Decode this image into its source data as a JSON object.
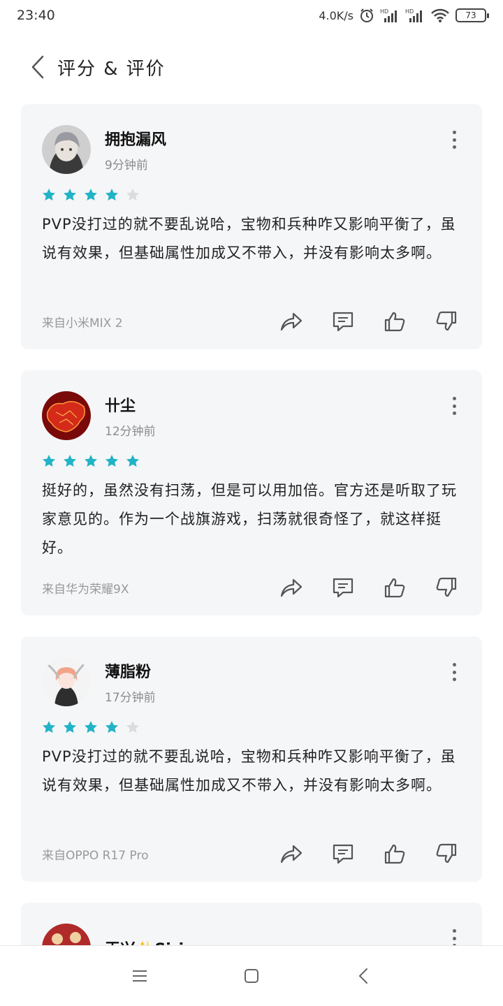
{
  "status_bar": {
    "time": "23:40",
    "speed": "4.0K/s",
    "battery": "73",
    "hd1": "HD",
    "hd2": "HD"
  },
  "header": {
    "title": "评分 & 评价",
    "back_icon": "chevron-left-icon"
  },
  "colors": {
    "star_filled": "#21b3c6",
    "star_empty": "#dcdcdc",
    "card_bg": "#f5f6f8"
  },
  "reviews": [
    {
      "username": "拥抱漏风",
      "time": "9分钟前",
      "rating": 4,
      "text": "PVP没打过的就不要乱说哈，宝物和兵种咋又影响平衡了，虽说有效果，但基础属性加成又不带入，并没有影响太多啊。",
      "device": "来自小米MIX 2"
    },
    {
      "username": "卄尘",
      "time": "12分钟前",
      "rating": 5,
      "text": "挺好的，虽然没有扫荡，但是可以用加倍。官方还是听取了玩家意见的。作为一个战旗游戏，扫荡就很奇怪了，就这样挺好。",
      "device": "来自华为荣耀9X"
    },
    {
      "username": "薄脂粉",
      "time": "17分钟前",
      "rating": 4,
      "text": "PVP没打过的就不要乱说哈，宝物和兵种咋又影响平衡了，虽说有效果，但基础属性加成又不带入，并没有影响太多啊。",
      "device": "来自OPPO R17 Pro"
    },
    {
      "username": "王兴✨Sirius"
    }
  ],
  "nav": {
    "menu_icon": "menu-icon",
    "home_icon": "square-home-icon",
    "back_icon": "back-triangle-icon"
  }
}
